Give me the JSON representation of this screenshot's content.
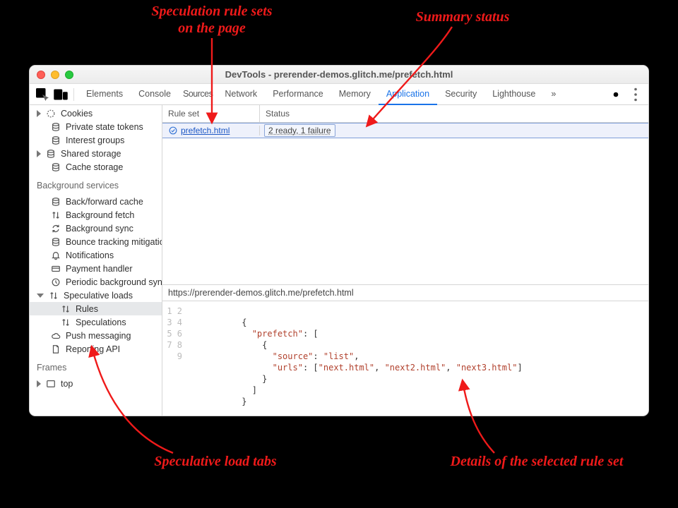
{
  "annotations": {
    "rule_sets": "Speculation rule sets\non the page",
    "rule_sets_l1": "Speculation rule sets",
    "rule_sets_l2": "on the page",
    "summary_status": "Summary status",
    "load_tabs": "Speculative load tabs",
    "details": "Details of the selected rule set"
  },
  "window": {
    "title": "DevTools - prerender-demos.glitch.me/prefetch.html"
  },
  "devtools_tabs": {
    "elements": "Elements",
    "console": "Console",
    "sources": "Sources",
    "network": "Network",
    "performance": "Performance",
    "memory": "Memory",
    "application": "Application",
    "security": "Security",
    "lighthouse": "Lighthouse",
    "more": "»"
  },
  "sidebar": {
    "cookies": "Cookies",
    "private_state_tokens": "Private state tokens",
    "interest_groups": "Interest groups",
    "shared_storage": "Shared storage",
    "cache_storage": "Cache storage",
    "background_services": "Background services",
    "back_forward_cache": "Back/forward cache",
    "background_fetch": "Background fetch",
    "background_sync": "Background sync",
    "bounce_tracking": "Bounce tracking mitigations",
    "notifications": "Notifications",
    "payment_handler": "Payment handler",
    "periodic_background_sync": "Periodic background sync",
    "speculative_loads": "Speculative loads",
    "rules": "Rules",
    "speculations": "Speculations",
    "push_messaging": "Push messaging",
    "reporting_api": "Reporting API",
    "frames": "Frames",
    "top": "top"
  },
  "grid": {
    "col_rule_set": "Rule set",
    "col_status": "Status",
    "row_ruleset": "prefetch.html",
    "row_status": "2 ready, 1 failure",
    "url": "https://prerender-demos.glitch.me/prefetch.html"
  },
  "code": {
    "line_numbers": "1\n2\n3\n4\n5\n6\n7\n8\n9",
    "l2": "{",
    "l3a": "\"prefetch\"",
    "l3b": ": [",
    "l4": "{",
    "l5a": "\"source\"",
    "l5b": ": ",
    "l5c": "\"list\"",
    "l5d": ",",
    "l6a": "\"urls\"",
    "l6b": ": [",
    "l6c": "\"next.html\"",
    "l6d": ", ",
    "l6e": "\"next2.html\"",
    "l6f": ", ",
    "l6g": "\"next3.html\"",
    "l6h": "]",
    "l7": "}",
    "l8": "]",
    "l9": "}"
  },
  "chart_data": {
    "type": "table",
    "columns": [
      "Rule set",
      "Status"
    ],
    "rows": [
      [
        "prefetch.html",
        "2 ready, 1 failure"
      ]
    ]
  }
}
